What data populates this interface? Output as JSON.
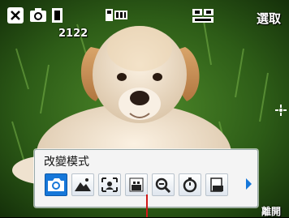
{
  "status_bar": {
    "shots_remaining": "2122",
    "options_label": "選取"
  },
  "mode_panel": {
    "title": "改變模式",
    "modes": [
      {
        "name": "auto-mode",
        "icon": "camera-auto-icon",
        "selected": true
      },
      {
        "name": "landscape-mode",
        "icon": "mountain-icon",
        "selected": false
      },
      {
        "name": "portrait-mode",
        "icon": "portrait-frame-icon",
        "selected": false
      },
      {
        "name": "night-scene-mode",
        "icon": "night-scene-icon",
        "selected": false
      },
      {
        "name": "macro-mode",
        "icon": "magnifier-icon",
        "selected": false
      },
      {
        "name": "self-timer-mode",
        "icon": "timer-icon",
        "selected": false
      },
      {
        "name": "document-mode",
        "icon": "document-icon",
        "selected": false
      }
    ]
  },
  "softkeys": {
    "right": "離開"
  },
  "colors": {
    "selected_blue": "#1677d9",
    "pointer_red": "#d01818"
  }
}
